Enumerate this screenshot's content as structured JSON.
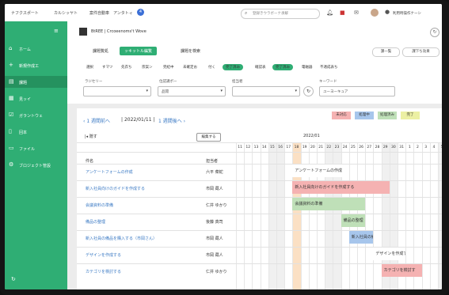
{
  "topbar": {
    "nav": [
      "ナフクスポート",
      "カルシッヤト",
      "案件自動車",
      "アンタトィ"
    ],
    "badge": "4",
    "search_placeholder": "登録きウラボーナ承解",
    "icons": [
      "search-icon",
      "bell-icon",
      "chat-icon",
      "alert-icon",
      "avatar",
      "grid-icon"
    ],
    "user": "利用時操作ナーシ"
  },
  "sidebar": {
    "items": [
      {
        "label": "ホーム",
        "icon": "home-icon"
      },
      {
        "label": "新規作成工",
        "icon": "plus-icon"
      },
      {
        "label": "課題",
        "icon": "list-icon"
      },
      {
        "label": "見ッイ",
        "icon": "table-icon"
      },
      {
        "label": "ガラントウェ",
        "icon": "check-icon"
      },
      {
        "label": "回本",
        "icon": "doc-icon"
      },
      {
        "label": "ファイル",
        "icon": "folder-icon"
      },
      {
        "label": "ブロジェクト管設",
        "icon": "gear-icon"
      }
    ]
  },
  "header": {
    "title": "BtREE | Crcoeenoms't Wove",
    "tabs": [
      "課題覧処",
      "ッキットル編覧",
      "課題を検索"
    ],
    "buttons": [
      "課一覧",
      "課下ち効果"
    ]
  },
  "filters": {
    "chips": [
      "選択",
      "すマツ",
      "先衣ち",
      "宗案ン",
      "完結中",
      "未確定お",
      "付く",
      "完了済み",
      "確認表",
      "完了済み",
      "電磁器",
      "不適成表ち"
    ],
    "labels": [
      "ラジセリー",
      "位認識ポー",
      "担当者",
      "キーワード"
    ],
    "values": [
      "",
      "品開",
      "",
      "ユーヨーキュア"
    ]
  },
  "gantt": {
    "legend": [
      {
        "label": "未対応",
        "color": "#f5b2b2"
      },
      {
        "label": "処理中",
        "color": "#a7c6ec"
      },
      {
        "label": "処理済み",
        "color": "#bfe0b8"
      },
      {
        "label": "完了",
        "color": "#ecf0a3"
      }
    ],
    "nav_prev": "1 週間前へ",
    "date": "2022/01/11",
    "nav_next": "1 週間後へ",
    "collapse": "隠す",
    "edit_button": "編集する",
    "month": "2022/01",
    "col_task": "件名",
    "col_owner": "担当者",
    "days": [
      "11",
      "12",
      "13",
      "14",
      "15",
      "16",
      "17",
      "18",
      "19",
      "20",
      "21",
      "22",
      "23",
      "24",
      "25",
      "26",
      "27",
      "28",
      "29",
      "30",
      "31",
      "1",
      "2",
      "3",
      "4",
      "5"
    ],
    "tasks": [
      {
        "name": "アンケートフォームの作成",
        "owner": "六平 菜蛇",
        "start": 7,
        "len": 7,
        "color": "#ffffff",
        "label": "アンケートフォームの作成"
      },
      {
        "name": "新入社員向けのガイドを作成する",
        "owner": "市岡 蔵人",
        "start": 7,
        "len": 12,
        "color": "#f5b2b2",
        "label": "新入社員向けのガイドを作成する"
      },
      {
        "name": "会議資料の準備",
        "owner": "仁井 ゆかり",
        "start": 7,
        "len": 9,
        "color": "#bfe0b8",
        "label": "会議資料の準備"
      },
      {
        "name": "備品の整理",
        "owner": "後藤 真司",
        "start": 13,
        "len": 3,
        "color": "#bfe0b8",
        "label": "備品の整理"
      },
      {
        "name": "新入社員の備品を購入する（市岡さん）",
        "owner": "市岡 蔵人",
        "start": 14,
        "len": 3,
        "color": "#a7c6ec",
        "label": "新入社員の備品を購入する（市岡さん）"
      },
      {
        "name": "デザインを作成する",
        "owner": "市岡 蔵人",
        "start": 17,
        "len": 4,
        "color": "#ffffff",
        "label": "デザインを作成する"
      },
      {
        "name": "カテゴリを検討する",
        "owner": "仁井 ゆかり",
        "start": 18,
        "len": 5,
        "color": "#f5b2b2",
        "label": "カテゴリを検討す"
      }
    ]
  }
}
